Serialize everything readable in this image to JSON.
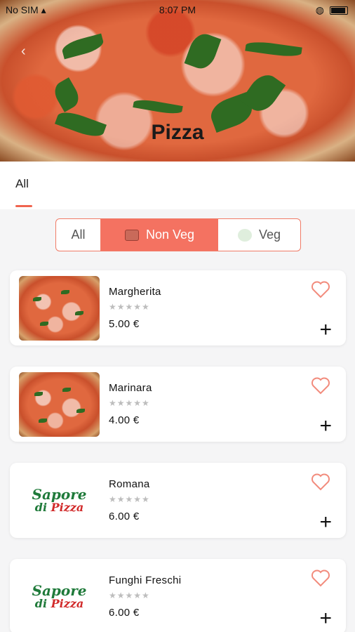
{
  "status_bar": {
    "carrier": "No SIM",
    "time": "8:07 PM"
  },
  "header": {
    "title": "Pizza"
  },
  "tabs": [
    {
      "label": "All",
      "active": true
    }
  ],
  "filter": {
    "options": [
      {
        "label": "All",
        "selected": false
      },
      {
        "label": "Non Veg",
        "selected": true
      },
      {
        "label": "Veg",
        "selected": false
      }
    ]
  },
  "products": [
    {
      "name": "Margherita",
      "price": "5.00 €",
      "rating": "★★★★★",
      "image": "pizza"
    },
    {
      "name": "Marinara",
      "price": "4.00 €",
      "rating": "★★★★★",
      "image": "pizza"
    },
    {
      "name": "Romana",
      "price": "6.00 €",
      "rating": "★★★★★",
      "image": "logo"
    },
    {
      "name": "Funghi Freschi",
      "price": "6.00 €",
      "rating": "★★★★★",
      "image": "logo"
    }
  ],
  "logo": {
    "top": "Sapore",
    "di": "di",
    "pizza": "Pizza"
  },
  "colors": {
    "accent": "#f47261",
    "accent_border": "#f07b67",
    "background": "#f5f5f6"
  },
  "icons": {
    "heart": "heart-outline-icon",
    "add": "plus-icon",
    "back": "chevron-left-icon"
  }
}
